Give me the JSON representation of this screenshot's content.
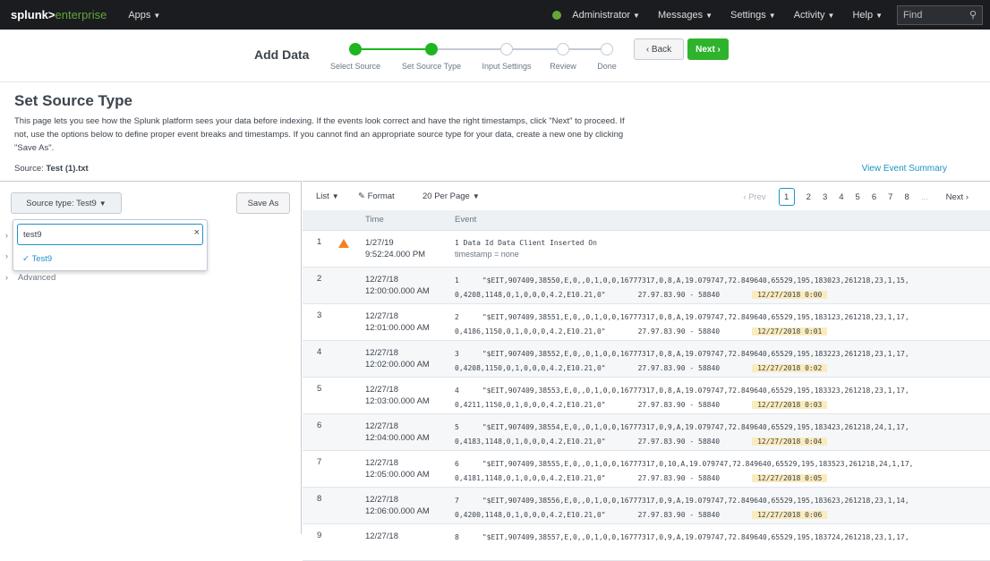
{
  "topbar": {
    "logo_a": "splunk>",
    "logo_b": "enterprise",
    "apps": "Apps",
    "menus": [
      "Administrator",
      "Messages",
      "Settings",
      "Activity",
      "Help"
    ],
    "find_placeholder": "Find",
    "status_color": "#65a637"
  },
  "wizard": {
    "title": "Add Data",
    "steps": [
      "Select Source",
      "Set Source Type",
      "Input Settings",
      "Review",
      "Done"
    ],
    "completed_steps": 2,
    "back_label": "‹ Back",
    "next_label": "Next ›",
    "accent": "#2fb32d"
  },
  "intro": {
    "title": "Set Source Type",
    "description": "This page lets you see how the Splunk platform sees your data before indexing. If the events look correct and have the right timestamps, click \"Next\" to proceed. If not, use the options below to define proper event breaks and timestamps. If you cannot find an appropriate source type for your data, create a new one by clicking \"Save As\".",
    "source_label": "Source:",
    "source_value": "Test (1).txt",
    "view_summary": "View Event Summary"
  },
  "left": {
    "sourcetype_label": "Source type: Test9",
    "save_as": "Save As",
    "search_value": "test9",
    "clear_icon": "×",
    "option": "Test9",
    "advanced": "Advanced"
  },
  "toolbar": {
    "list": "List",
    "format": "Format",
    "per_page": "20 Per Page",
    "prev": "‹ Prev",
    "pages": [
      "1",
      "2",
      "3",
      "4",
      "5",
      "6",
      "7",
      "8"
    ],
    "current_page": "1",
    "ellipsis": "...",
    "next": "Next ›"
  },
  "table": {
    "headers": [
      "",
      "",
      "Time",
      "Event"
    ],
    "rows": [
      {
        "n": "1",
        "warn": true,
        "date": "1/27/19",
        "time": "9:52:24.000 PM",
        "line1": "1   Data Id Data   Client  Inserted On",
        "line2": "timestamp = none",
        "idx": "",
        "ip": "",
        "ts": ""
      },
      {
        "n": "2",
        "warn": false,
        "date": "12/27/18",
        "time": "12:00:00.000 AM",
        "line1": "\"$EIT,907409,38550,E,0,,0,1,0,0,16777317,0,8,A,19.079747,72.849640,65529,195,183023,261218,23,1,15,",
        "line2": "0,4208,1148,0,1,0,0,0,4.2,E10.21,0\"",
        "idx": "1",
        "ip": "27.97.83.90 - 58840",
        "ts": "12/27/2018 0:00"
      },
      {
        "n": "3",
        "warn": false,
        "date": "12/27/18",
        "time": "12:01:00.000 AM",
        "line1": "\"$EIT,907409,38551,E,0,,0,1,0,0,16777317,0,8,A,19.079747,72.849640,65529,195,183123,261218,23,1,17,",
        "line2": "0,4186,1150,0,1,0,0,0,4.2,E10.21,0\"",
        "idx": "2",
        "ip": "27.97.83.90 - 58840",
        "ts": "12/27/2018 0:01"
      },
      {
        "n": "4",
        "warn": false,
        "date": "12/27/18",
        "time": "12:02:00.000 AM",
        "line1": "\"$EIT,907409,38552,E,0,,0,1,0,0,16777317,0,8,A,19.079747,72.849640,65529,195,183223,261218,23,1,17,",
        "line2": "0,4208,1150,0,1,0,0,0,4.2,E10.21,0\"",
        "idx": "3",
        "ip": "27.97.83.90 - 58840",
        "ts": "12/27/2018 0:02"
      },
      {
        "n": "5",
        "warn": false,
        "date": "12/27/18",
        "time": "12:03:00.000 AM",
        "line1": "\"$EIT,907409,38553,E,0,,0,1,0,0,16777317,0,8,A,19.079747,72.849640,65529,195,183323,261218,23,1,17,",
        "line2": "0,4211,1150,0,1,0,0,0,4.2,E10.21,0\"",
        "idx": "4",
        "ip": "27.97.83.90 - 58840",
        "ts": "12/27/2018 0:03"
      },
      {
        "n": "6",
        "warn": false,
        "date": "12/27/18",
        "time": "12:04:00.000 AM",
        "line1": "\"$EIT,907409,38554,E,0,,0,1,0,0,16777317,0,9,A,19.079747,72.849640,65529,195,183423,261218,24,1,17,",
        "line2": "0,4183,1148,0,1,0,0,0,4.2,E10.21,0\"",
        "idx": "5",
        "ip": "27.97.83.90 - 58840",
        "ts": "12/27/2018 0:04"
      },
      {
        "n": "7",
        "warn": false,
        "date": "12/27/18",
        "time": "12:05:00.000 AM",
        "line1": "\"$EIT,907409,38555,E,0,,0,1,0,0,16777317,0,10,A,19.079747,72.849640,65529,195,183523,261218,24,1,17,",
        "line2": "0,4181,1148,0,1,0,0,0,4.2,E10.21,0\"",
        "idx": "6",
        "ip": "27.97.83.90 - 58840",
        "ts": "12/27/2018 0:05"
      },
      {
        "n": "8",
        "warn": false,
        "date": "12/27/18",
        "time": "12:06:00.000 AM",
        "line1": "\"$EIT,907409,38556,E,0,,0,1,0,0,16777317,0,9,A,19.079747,72.849640,65529,195,183623,261218,23,1,14,",
        "line2": "0,4200,1148,0,1,0,0,0,4.2,E10.21,0\"",
        "idx": "7",
        "ip": "27.97.83.90 - 58840",
        "ts": "12/27/2018 0:06"
      },
      {
        "n": "9",
        "warn": false,
        "date": "12/27/18",
        "time": "",
        "line1": "\"$EIT,907409,38557,E,0,,0,1,0,0,16777317,0,9,A,19.079747,72.849640,65529,195,183724,261218,23,1,17,",
        "line2": "",
        "idx": "8",
        "ip": "",
        "ts": ""
      }
    ]
  }
}
